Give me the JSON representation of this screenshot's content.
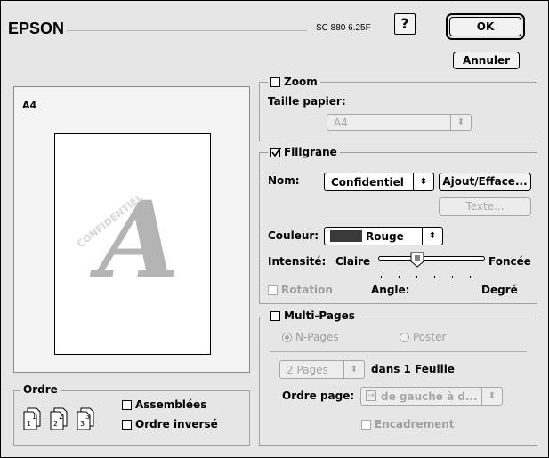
{
  "header": {
    "brand": "EPSON",
    "model": "SC 880 6.25F",
    "help_label": "?",
    "ok_label": "OK",
    "cancel_label": "Annuler"
  },
  "preview": {
    "paper_label": "A4",
    "page_letter": "A",
    "page_watermark": "CONFIDENTIEL"
  },
  "order": {
    "title": "Ordre",
    "collate_label": "Assemblées",
    "reverse_label": "Ordre inversé",
    "icons": [
      "1",
      "2",
      "3"
    ]
  },
  "zoom": {
    "title": "Zoom",
    "paper_size_label": "Taille papier:",
    "paper_size_value": "A4",
    "checked": false
  },
  "watermark": {
    "title": "Filigrane",
    "checked": true,
    "name_label": "Nom:",
    "name_value": "Confidentiel",
    "add_remove_label": "Ajout/Efface...",
    "text_label": "Texte...",
    "color_label": "Couleur:",
    "color_value": "Rouge",
    "color_swatch": "#3a3a3a",
    "intensity_label": "Intensité:",
    "intensity_light": "Claire",
    "intensity_dark": "Foncée",
    "intensity_level": 0.35,
    "rotation_label": "Rotation",
    "angle_label": "Angle:",
    "degree_label": "Degré"
  },
  "multipage": {
    "title": "Multi-Pages",
    "checked": false,
    "npages_label": "N-Pages",
    "poster_label": "Poster",
    "pages_value": "2 Pages",
    "per_sheet_label": "dans 1 Feuille",
    "page_order_label": "Ordre page:",
    "page_order_value": "de gauche à d...",
    "border_label": "Encadrement"
  }
}
